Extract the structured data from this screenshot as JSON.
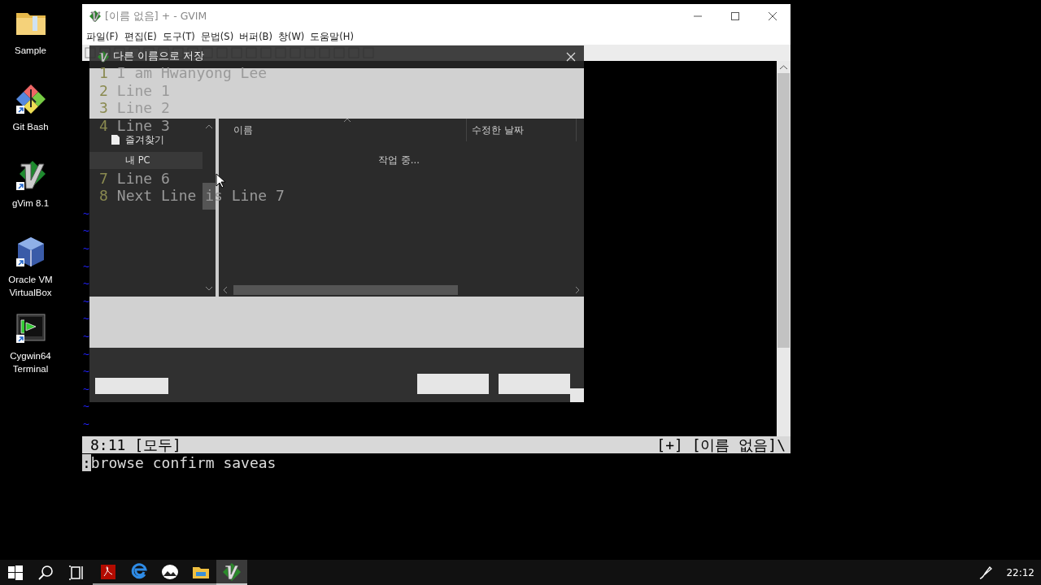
{
  "desktop_icons": [
    {
      "label": "Sample",
      "kind": "folder",
      "shortcut": false
    },
    {
      "label": "Git Bash",
      "kind": "gitbash",
      "shortcut": true
    },
    {
      "label": "gVim 8.1",
      "kind": "gvim",
      "shortcut": true
    },
    {
      "label": "Oracle VM VirtualBox",
      "kind": "virtualbox",
      "shortcut": true
    },
    {
      "label": "Cygwin64 Terminal",
      "kind": "cygwin",
      "shortcut": true
    }
  ],
  "gvim": {
    "title": "[이름 없음] + - GVIM",
    "menu": [
      "파일(F)",
      "편집(E)",
      "도구(T)",
      "문법(S)",
      "버퍼(B)",
      "창(W)",
      "도움말(H)"
    ],
    "lines": [
      {
        "kind": "text",
        "number": "1",
        "text": "I am Hwanyong Lee"
      },
      {
        "kind": "text",
        "number": "2",
        "text": "Line 1"
      },
      {
        "kind": "text",
        "number": "3",
        "text": "Line 2"
      },
      {
        "kind": "text",
        "number": "4",
        "text": "Line 3"
      },
      {
        "kind": "covered"
      },
      {
        "kind": "covered"
      },
      {
        "kind": "text",
        "number": "7",
        "text": "Line 6"
      },
      {
        "kind": "text",
        "number": "8",
        "text": "Next Line is Line 7"
      }
    ],
    "tildes": [
      "~",
      "~",
      "~",
      "~",
      "~",
      "~",
      "~",
      "~",
      "~",
      "~",
      "~",
      "~",
      "~"
    ],
    "status": {
      "left": "8:11 [모두]",
      "right": "[+] [이름 없음]\\"
    },
    "command": {
      "cursor": ":",
      "text": "browse confirm saveas"
    }
  },
  "dialog": {
    "title": "다른 이름으로 저장",
    "nav": [
      {
        "label": "즐겨찾기",
        "kind": "favorites",
        "selected": false
      },
      {
        "label": "내 PC",
        "kind": "pc",
        "selected": true
      }
    ],
    "columns": [
      "이름",
      "수정한 날짜"
    ],
    "status_text": "작업 중..."
  },
  "taskbar": {
    "items": [
      {
        "kind": "start",
        "running": false,
        "active": false
      },
      {
        "kind": "search",
        "running": false,
        "active": false
      },
      {
        "kind": "taskview",
        "running": false,
        "active": false
      },
      {
        "kind": "pdf",
        "running": true,
        "active": false
      },
      {
        "kind": "browser",
        "running": true,
        "active": false
      },
      {
        "kind": "photos",
        "running": true,
        "active": false
      },
      {
        "kind": "explorer",
        "running": true,
        "active": false
      },
      {
        "kind": "gvim",
        "running": true,
        "active": true
      }
    ],
    "clock": "22:12"
  }
}
